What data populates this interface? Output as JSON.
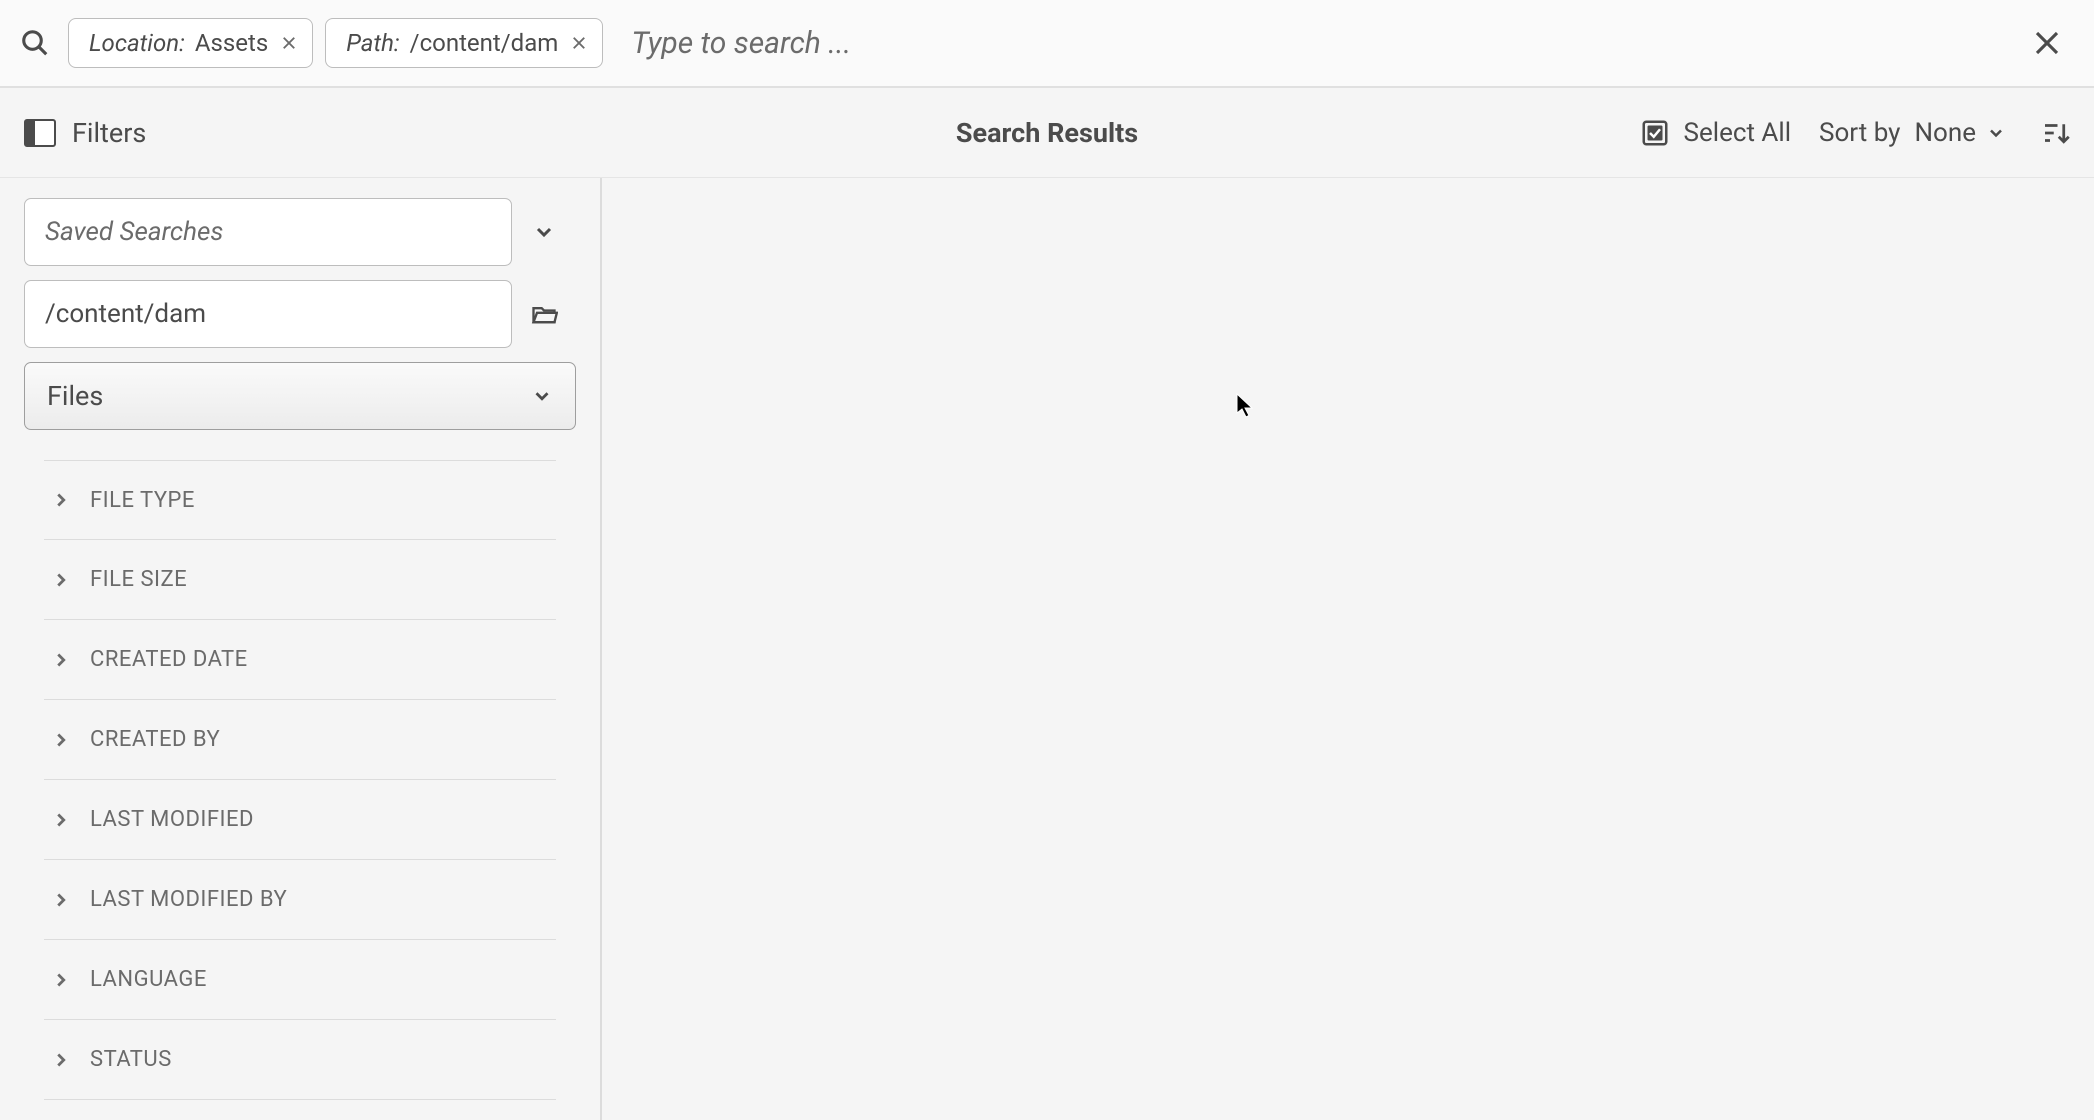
{
  "search": {
    "placeholder": "Type to search ...",
    "value": "",
    "chips": [
      {
        "label": "Location:",
        "value": " Assets"
      },
      {
        "label": "Path:",
        "value": "/content/dam"
      }
    ]
  },
  "subheader": {
    "filters_label": "Filters",
    "results_title": "Search Results",
    "select_all_label": "Select All",
    "sortby_label": "Sort by",
    "sort_value": "None"
  },
  "sidebar": {
    "saved_searches_placeholder": "Saved Searches",
    "path_value": "/content/dam",
    "type_value": "Files",
    "facets": [
      "FILE TYPE",
      "FILE SIZE",
      "CREATED DATE",
      "CREATED BY",
      "LAST MODIFIED",
      "LAST MODIFIED BY",
      "LANGUAGE",
      "STATUS"
    ]
  }
}
